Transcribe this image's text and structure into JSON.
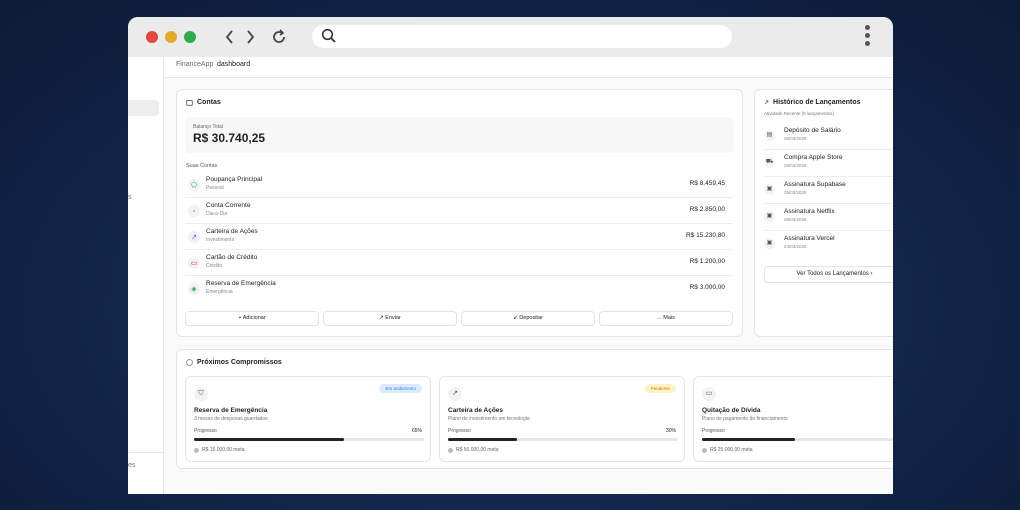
{
  "colors": {
    "accent_blue": "#3b82f6",
    "badge_blue_bg": "#dbeafe",
    "badge_yellow_bg": "#fef3c7",
    "badge_yellow_text": "#d97706"
  },
  "breadcrumb": {
    "app": "FinanceApp",
    "page": "dashboard"
  },
  "sidebar": {
    "fragment1": "s",
    "fragment2": "es"
  },
  "contas": {
    "title": "Contas",
    "balance_label": "Balanço Total",
    "balance_value": "R$ 30.740,25",
    "section_label": "Suas Contas",
    "accounts": [
      {
        "name": "Poupança Principal",
        "type": "Pessoal",
        "amount": "R$ 8.459,45",
        "icon": "piggy-bank-icon"
      },
      {
        "name": "Conta Corrente",
        "type": "Dia-a-Dia",
        "amount": "R$ 2.850,00",
        "icon": "wallet-icon"
      },
      {
        "name": "Carteira de Ações",
        "type": "Investimento",
        "amount": "R$ 15.230,80",
        "icon": "trending-up-icon"
      },
      {
        "name": "Cartão de Crédito",
        "type": "Crédito",
        "amount": "R$ 1.200,00",
        "icon": "credit-card-icon"
      },
      {
        "name": "Reserva de Emergência",
        "type": "Emergência",
        "amount": "R$ 3.000,00",
        "icon": "shield-icon"
      }
    ],
    "buttons": [
      "+ Adicionar",
      "↗ Enviar",
      "↙ Depositar",
      "... Mais"
    ]
  },
  "historico": {
    "title": "Histórico de Lançamentos",
    "subtitle": "Atividade Recente (5 lançamentos)",
    "items": [
      {
        "name": "Depósito de Salário",
        "date": "26/03/2026",
        "icon": "wallet-icon"
      },
      {
        "name": "Compra Apple Store",
        "date": "26/03/2026",
        "icon": "cart-icon"
      },
      {
        "name": "Assinatura Supabase",
        "date": "25/03/2026",
        "icon": "receipt-icon"
      },
      {
        "name": "Assinatura Netflix",
        "date": "25/03/2026",
        "icon": "receipt-icon"
      },
      {
        "name": "Assinatura Vercel",
        "date": "24/03/2026",
        "icon": "receipt-icon"
      }
    ],
    "view_all": "Ver Todos os Lançamentos"
  },
  "compromissos": {
    "title": "Próximos Compromissos",
    "goals": [
      {
        "title": "Reserva de Emergência",
        "desc": "3 meses de despesas guardados",
        "badge": "Em andamento",
        "progress_label": "Progresso",
        "progress_pct": "65%",
        "progress": 0.65,
        "meta": "R$ 15.000,00 meta",
        "icon": "shield-icon"
      },
      {
        "title": "Carteira de Ações",
        "desc": "Plano de investimento em tecnologia",
        "badge": "Pendente",
        "progress_label": "Progresso",
        "progress_pct": "30%",
        "progress": 0.3,
        "meta": "R$ 50.000,00 meta",
        "icon": "trending-up-icon"
      },
      {
        "title": "Quitação de Dívida",
        "desc": "Plano de pagamento de financiamento",
        "badge": "",
        "progress_label": "Progresso",
        "progress_pct": "",
        "progress": 0.45,
        "meta": "R$ 25.000,00 meta",
        "icon": "credit-card-icon"
      }
    ]
  }
}
